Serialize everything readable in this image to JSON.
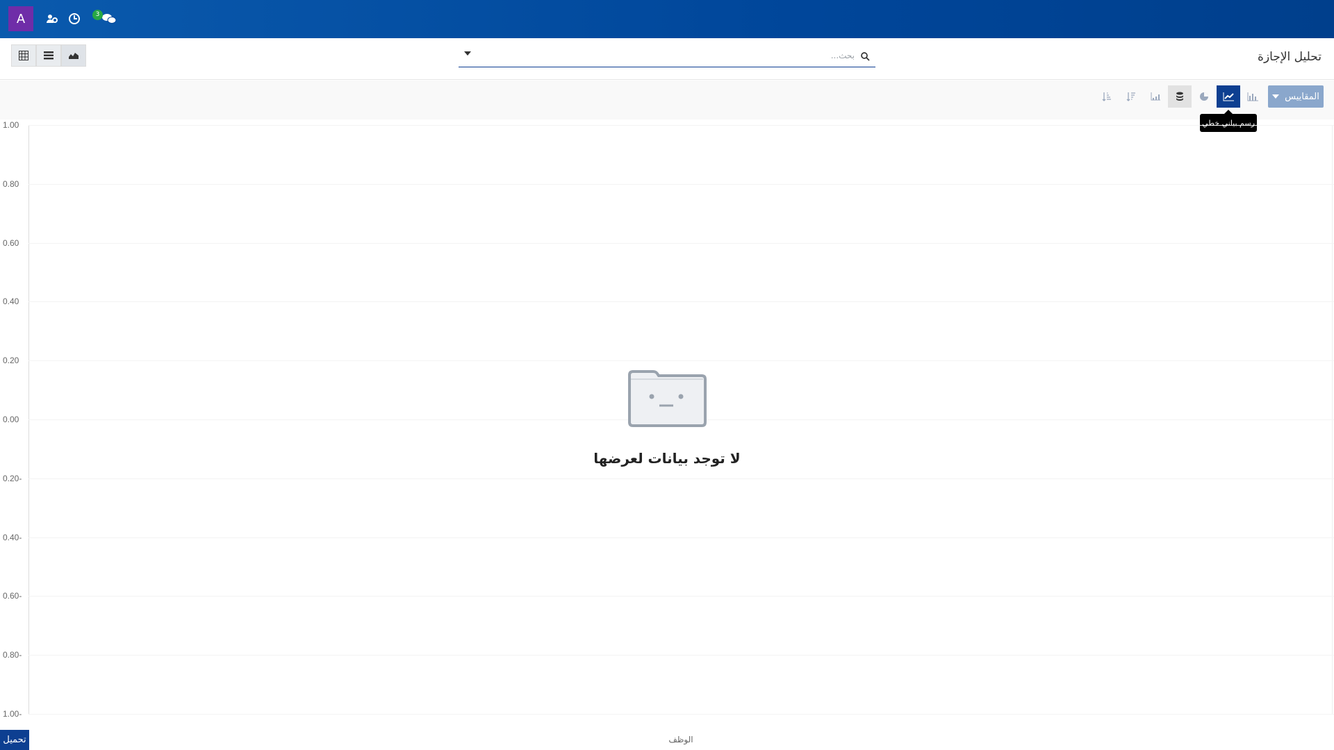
{
  "navbar": {
    "user_initial": "A",
    "chat_badge_count": "3",
    "icons": [
      "users-cog-icon",
      "clock-icon",
      "chat-icon"
    ]
  },
  "control_panel": {
    "title": "تحليل الإجازة",
    "search_placeholder": "بحث...",
    "view_buttons": [
      "graph-view-icon",
      "list-view-icon",
      "pivot-view-icon"
    ]
  },
  "toolbar": {
    "measures_label": "المقاييس",
    "chart_types": [
      "bar-chart-icon",
      "line-chart-icon",
      "pie-chart-icon"
    ],
    "active_chart": "line",
    "tooltip": "رسم بياني خطي"
  },
  "chart": {
    "y_ticks": [
      "1.00",
      "0.80",
      "0.60",
      "0.40",
      "0.20",
      "0.00",
      "-0.20",
      "-0.40",
      "-0.60",
      "-0.80",
      "-1.00"
    ],
    "x_label": "الوظف"
  },
  "chart_data": {
    "type": "line",
    "series": [],
    "ylim": [
      -1,
      1
    ],
    "ylabel": "",
    "xlabel": "الوظف",
    "grid": true
  },
  "empty_state": {
    "message": "لا توجد بيانات لعرضها"
  },
  "footer": {
    "download_label": "تحميل"
  }
}
